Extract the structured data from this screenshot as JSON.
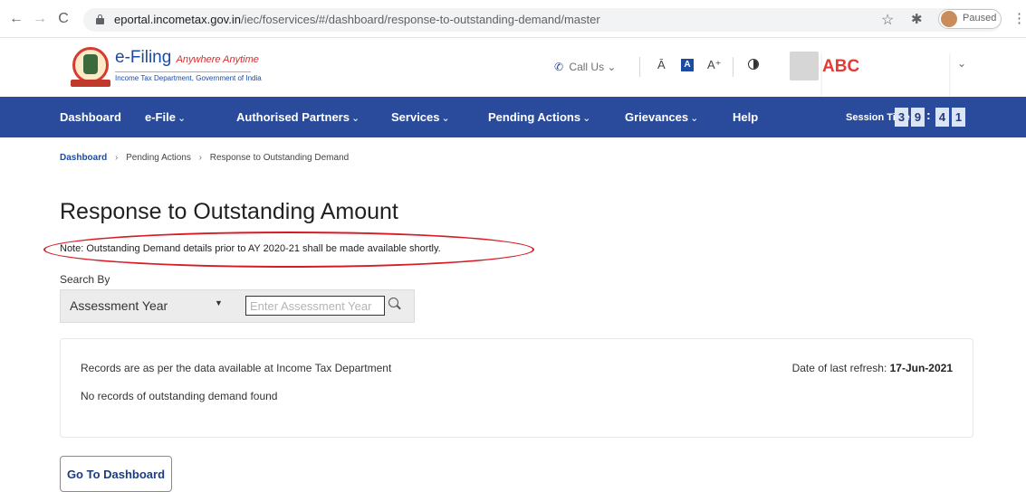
{
  "browser": {
    "back_icon": "←",
    "forward_icon": "→",
    "reload_icon": "C",
    "url_host": "eportal.incometax.gov.in",
    "url_path": "/iec/foservices/#/dashboard/response-to-outstanding-demand/master",
    "star_icon": "☆",
    "extensions_icon": "✱",
    "profile_status": "Paused",
    "menu_icon": "⋮"
  },
  "header": {
    "brand_title": "e-Filing",
    "brand_tagline": "Anywhere Anytime",
    "brand_subtitle": "Income Tax Department, Government of India",
    "call_us": "Call Us",
    "call_us_chevron": "⌄",
    "phone_icon": "✆",
    "font_decrease": "Ā",
    "font_normal": "A",
    "font_increase": "A⁺",
    "user_name": "ABC",
    "user_chevron": "⌄"
  },
  "nav": {
    "items": [
      {
        "label": "Dashboard",
        "chevron": ""
      },
      {
        "label": "e-File",
        "chevron": "⌄"
      },
      {
        "label": "Authorised Partners",
        "chevron": "⌄"
      },
      {
        "label": "Services",
        "chevron": "⌄"
      },
      {
        "label": "Pending Actions",
        "chevron": "⌄"
      },
      {
        "label": "Grievances",
        "chevron": "⌄"
      },
      {
        "label": "Help",
        "chevron": ""
      }
    ],
    "session_label": "Session Time",
    "timer_digits": [
      "3",
      "9",
      "4",
      "1"
    ],
    "timer_colon": ":"
  },
  "breadcrumb": {
    "items": [
      "Dashboard",
      "Pending Actions",
      "Response to Outstanding Demand"
    ],
    "separator": "›"
  },
  "page": {
    "title": "Response to Outstanding Amount",
    "note": "Note: Outstanding Demand details prior to AY 2020-21 shall be made available shortly.",
    "search_by_label": "Search By",
    "search_select_value": "Assessment Year",
    "search_caret": "▼",
    "search_placeholder": "Enter Assessment Year"
  },
  "records": {
    "note": "Records are as per the data available at Income Tax Department",
    "refresh_label": "Date of last refresh:",
    "refresh_date": "17-Jun-2021",
    "empty_message": "No records of outstanding demand found"
  },
  "actions": {
    "go_to_dashboard": "Go To Dashboard"
  },
  "colors": {
    "nav_background": "#2a4b9b",
    "brand_blue": "#1d4ba3",
    "highlight_red": "#d81b26",
    "user_name_red": "#e53935"
  }
}
